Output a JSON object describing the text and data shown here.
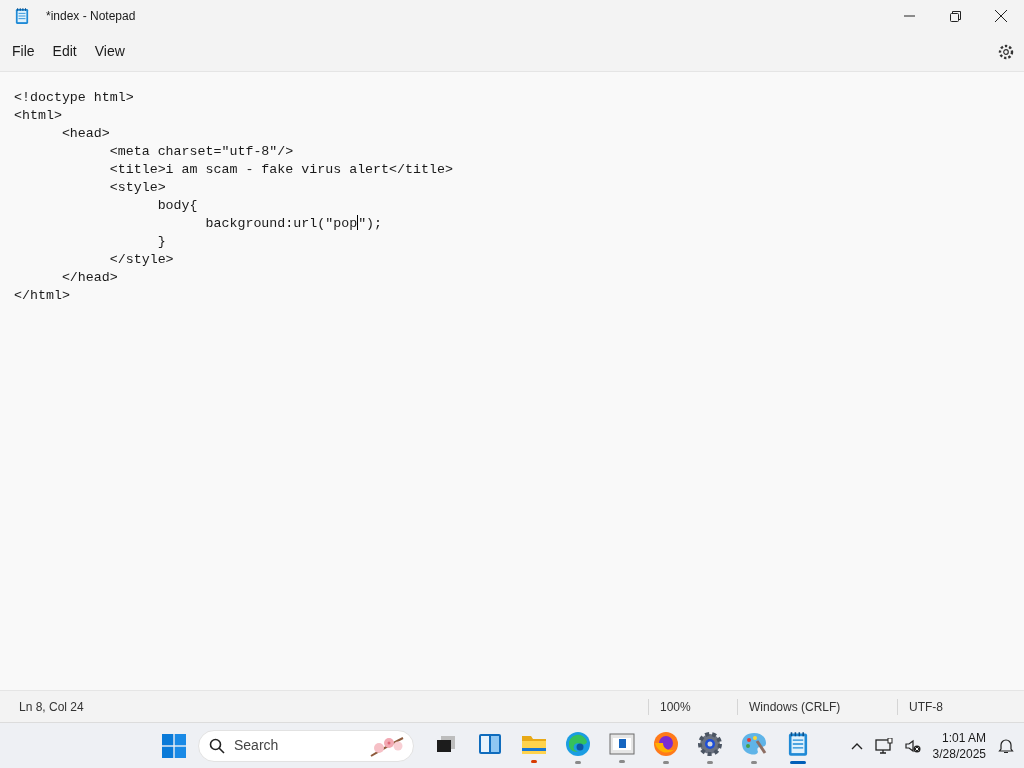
{
  "window": {
    "title": "*index - Notepad"
  },
  "menu": [
    "File",
    "Edit",
    "View"
  ],
  "editor": {
    "lines": [
      {
        "text": "<!doctype html>"
      },
      {
        "text": "<html>"
      },
      {
        "text": "\t<head>"
      },
      {
        "text": "\t\t<meta charset=\"utf-8\"/>"
      },
      {
        "text": "\t\t<title>i am scam - fake virus alert</title>"
      },
      {
        "text": "\t\t<style>"
      },
      {
        "text": "\t\t\tbody{"
      },
      {
        "text": "\t\t\t\tbackground:url(\"pop",
        "after_cursor": "\");"
      },
      {
        "text": "\t\t\t}"
      },
      {
        "text": "\t\t</style>"
      },
      {
        "text": "\t</head>"
      },
      {
        "text": "</html>"
      }
    ]
  },
  "status_bar": {
    "position": "Ln 8, Col 24",
    "zoom": "100%",
    "line_ending": "Windows (CRLF)",
    "encoding": "UTF-8"
  },
  "taskbar": {
    "search_placeholder": "Search",
    "apps": [
      {
        "kind": "taskview",
        "running": false,
        "alert": false,
        "selected": false
      },
      {
        "kind": "widgets",
        "running": false,
        "alert": false,
        "selected": false
      },
      {
        "kind": "explorer",
        "running": true,
        "alert": true,
        "selected": false
      },
      {
        "kind": "edge",
        "running": true,
        "alert": false,
        "selected": false
      },
      {
        "kind": "store",
        "running": true,
        "alert": false,
        "selected": false
      },
      {
        "kind": "firefox",
        "running": true,
        "alert": false,
        "selected": false
      },
      {
        "kind": "settings",
        "running": true,
        "alert": false,
        "selected": false
      },
      {
        "kind": "paint",
        "running": true,
        "alert": false,
        "selected": false
      },
      {
        "kind": "notepad",
        "running": true,
        "alert": false,
        "selected": true
      }
    ],
    "time": "1:01 AM",
    "date": "3/28/2025"
  }
}
